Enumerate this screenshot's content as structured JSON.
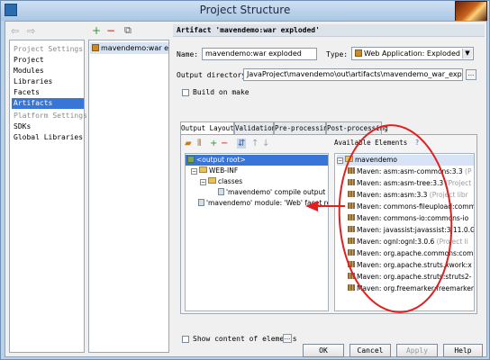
{
  "window": {
    "title": "Project Structure"
  },
  "nav": {
    "back": "⇦",
    "forward": "⇨",
    "items": [
      {
        "label": "Project Settings",
        "kind": "head"
      },
      {
        "label": "Project",
        "kind": "item"
      },
      {
        "label": "Modules",
        "kind": "item"
      },
      {
        "label": "Libraries",
        "kind": "item"
      },
      {
        "label": "Facets",
        "kind": "item"
      },
      {
        "label": "Artifacts",
        "kind": "selected"
      },
      {
        "label": "Platform Settings",
        "kind": "head"
      },
      {
        "label": "SDKs",
        "kind": "item"
      },
      {
        "label": "Global Libraries",
        "kind": "item"
      }
    ]
  },
  "artifacts_toolbar": {
    "add": "+",
    "remove": "−",
    "copy": "⧉"
  },
  "artifacts": [
    "mavendemo:war exploded"
  ],
  "detail": {
    "header": "Artifact 'mavendemo:war exploded'",
    "name_label": "Name:",
    "name_value": "mavendemo:war exploded",
    "type_label": "Type:",
    "type_value": "Web Application: Exploded",
    "output_label": "Output directory:",
    "output_value": "JavaProject\\mavendemo\\out\\artifacts\\mavendemo_war_exploded",
    "browse": "...",
    "build_on_make": "Build on make",
    "tabs": [
      "Output Layout",
      "Validation",
      "Pre-processing",
      "Post-processing"
    ],
    "available_label": "Available Elements",
    "help": "?",
    "show_content": "Show content of elements",
    "show_content_btn": "..."
  },
  "output_tree": [
    {
      "label": "<output root>",
      "indent": 0,
      "icon": "gear",
      "selected": true
    },
    {
      "label": "WEB-INF",
      "indent": 1,
      "icon": "folder",
      "fold": "−"
    },
    {
      "label": "classes",
      "indent": 2,
      "icon": "folder",
      "fold": "−"
    },
    {
      "label": "'mavendemo' compile output",
      "indent": 3,
      "icon": "file"
    },
    {
      "label": "'mavendemo' module: 'Web' facet reso",
      "indent": 1,
      "icon": "file"
    }
  ],
  "available_tree": {
    "root": "mavendemo",
    "items": [
      {
        "label": "Maven: asm:asm-commons:3.3",
        "suffix": " (P"
      },
      {
        "label": "Maven: asm:asm-tree:3.3",
        "suffix": " (Project"
      },
      {
        "label": "Maven: asm:asm:3.3",
        "suffix": " (Project libr"
      },
      {
        "label": "Maven: commons-fileupload:comm",
        "suffix": ""
      },
      {
        "label": "Maven: commons-io:commons-io",
        "suffix": ""
      },
      {
        "label": "Maven: javassist:javassist:3.11.0.G",
        "suffix": ""
      },
      {
        "label": "Maven: ognl:ognl:3.0.6",
        "suffix": " (Project li"
      },
      {
        "label": "Maven: org.apache.commons:comm",
        "suffix": ""
      },
      {
        "label": "Maven: org.apache.struts.xwork:x",
        "suffix": ""
      },
      {
        "label": "Maven: org.apache.struts:struts2-",
        "suffix": ""
      },
      {
        "label": "Maven: org.freemarker:freemarker",
        "suffix": ""
      }
    ]
  },
  "buttons": {
    "ok": "OK",
    "cancel": "Cancel",
    "apply": "Apply",
    "help": "Help"
  },
  "colors": {
    "selection": "#3875d7",
    "annotation": "#e02020"
  }
}
